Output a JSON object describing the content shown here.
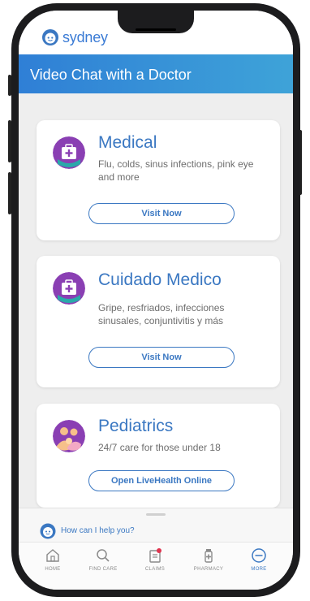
{
  "app": {
    "brand": "sydney"
  },
  "header": {
    "title": "Video Chat with a Doctor"
  },
  "cards": [
    {
      "title": "Medical",
      "description": "Flu, colds, sinus infections, pink eye and more",
      "button": "Visit Now",
      "icon": "medical-bag-icon",
      "icon_color": "#8a3fb3"
    },
    {
      "title": "Cuidado Medico",
      "description": "Gripe, resfriados, infecciones sinusales, conjuntivitis y más",
      "button": "Visit Now",
      "icon": "medical-bag-icon",
      "icon_color": "#8a3fb3"
    },
    {
      "title": "Pediatrics",
      "description": "24/7 care for those under 18",
      "button": "Open LiveHealth Online",
      "icon": "family-icon",
      "icon_color": "#8a3fb3"
    }
  ],
  "chat": {
    "prompt": "How can I help you?"
  },
  "nav": [
    {
      "label": "HOME",
      "icon": "home-icon"
    },
    {
      "label": "FIND CARE",
      "icon": "search-icon"
    },
    {
      "label": "CLAIMS",
      "icon": "claims-icon"
    },
    {
      "label": "PHARMACY",
      "icon": "pharmacy-icon"
    },
    {
      "label": "MORE",
      "icon": "more-icon",
      "active": true
    }
  ],
  "colors": {
    "accent": "#3b78c2",
    "header_gradient_start": "#2f7fd6",
    "header_gradient_end": "#3ea3d8",
    "icon_bg": "#8a3fb3",
    "teal": "#1fb5a8"
  }
}
